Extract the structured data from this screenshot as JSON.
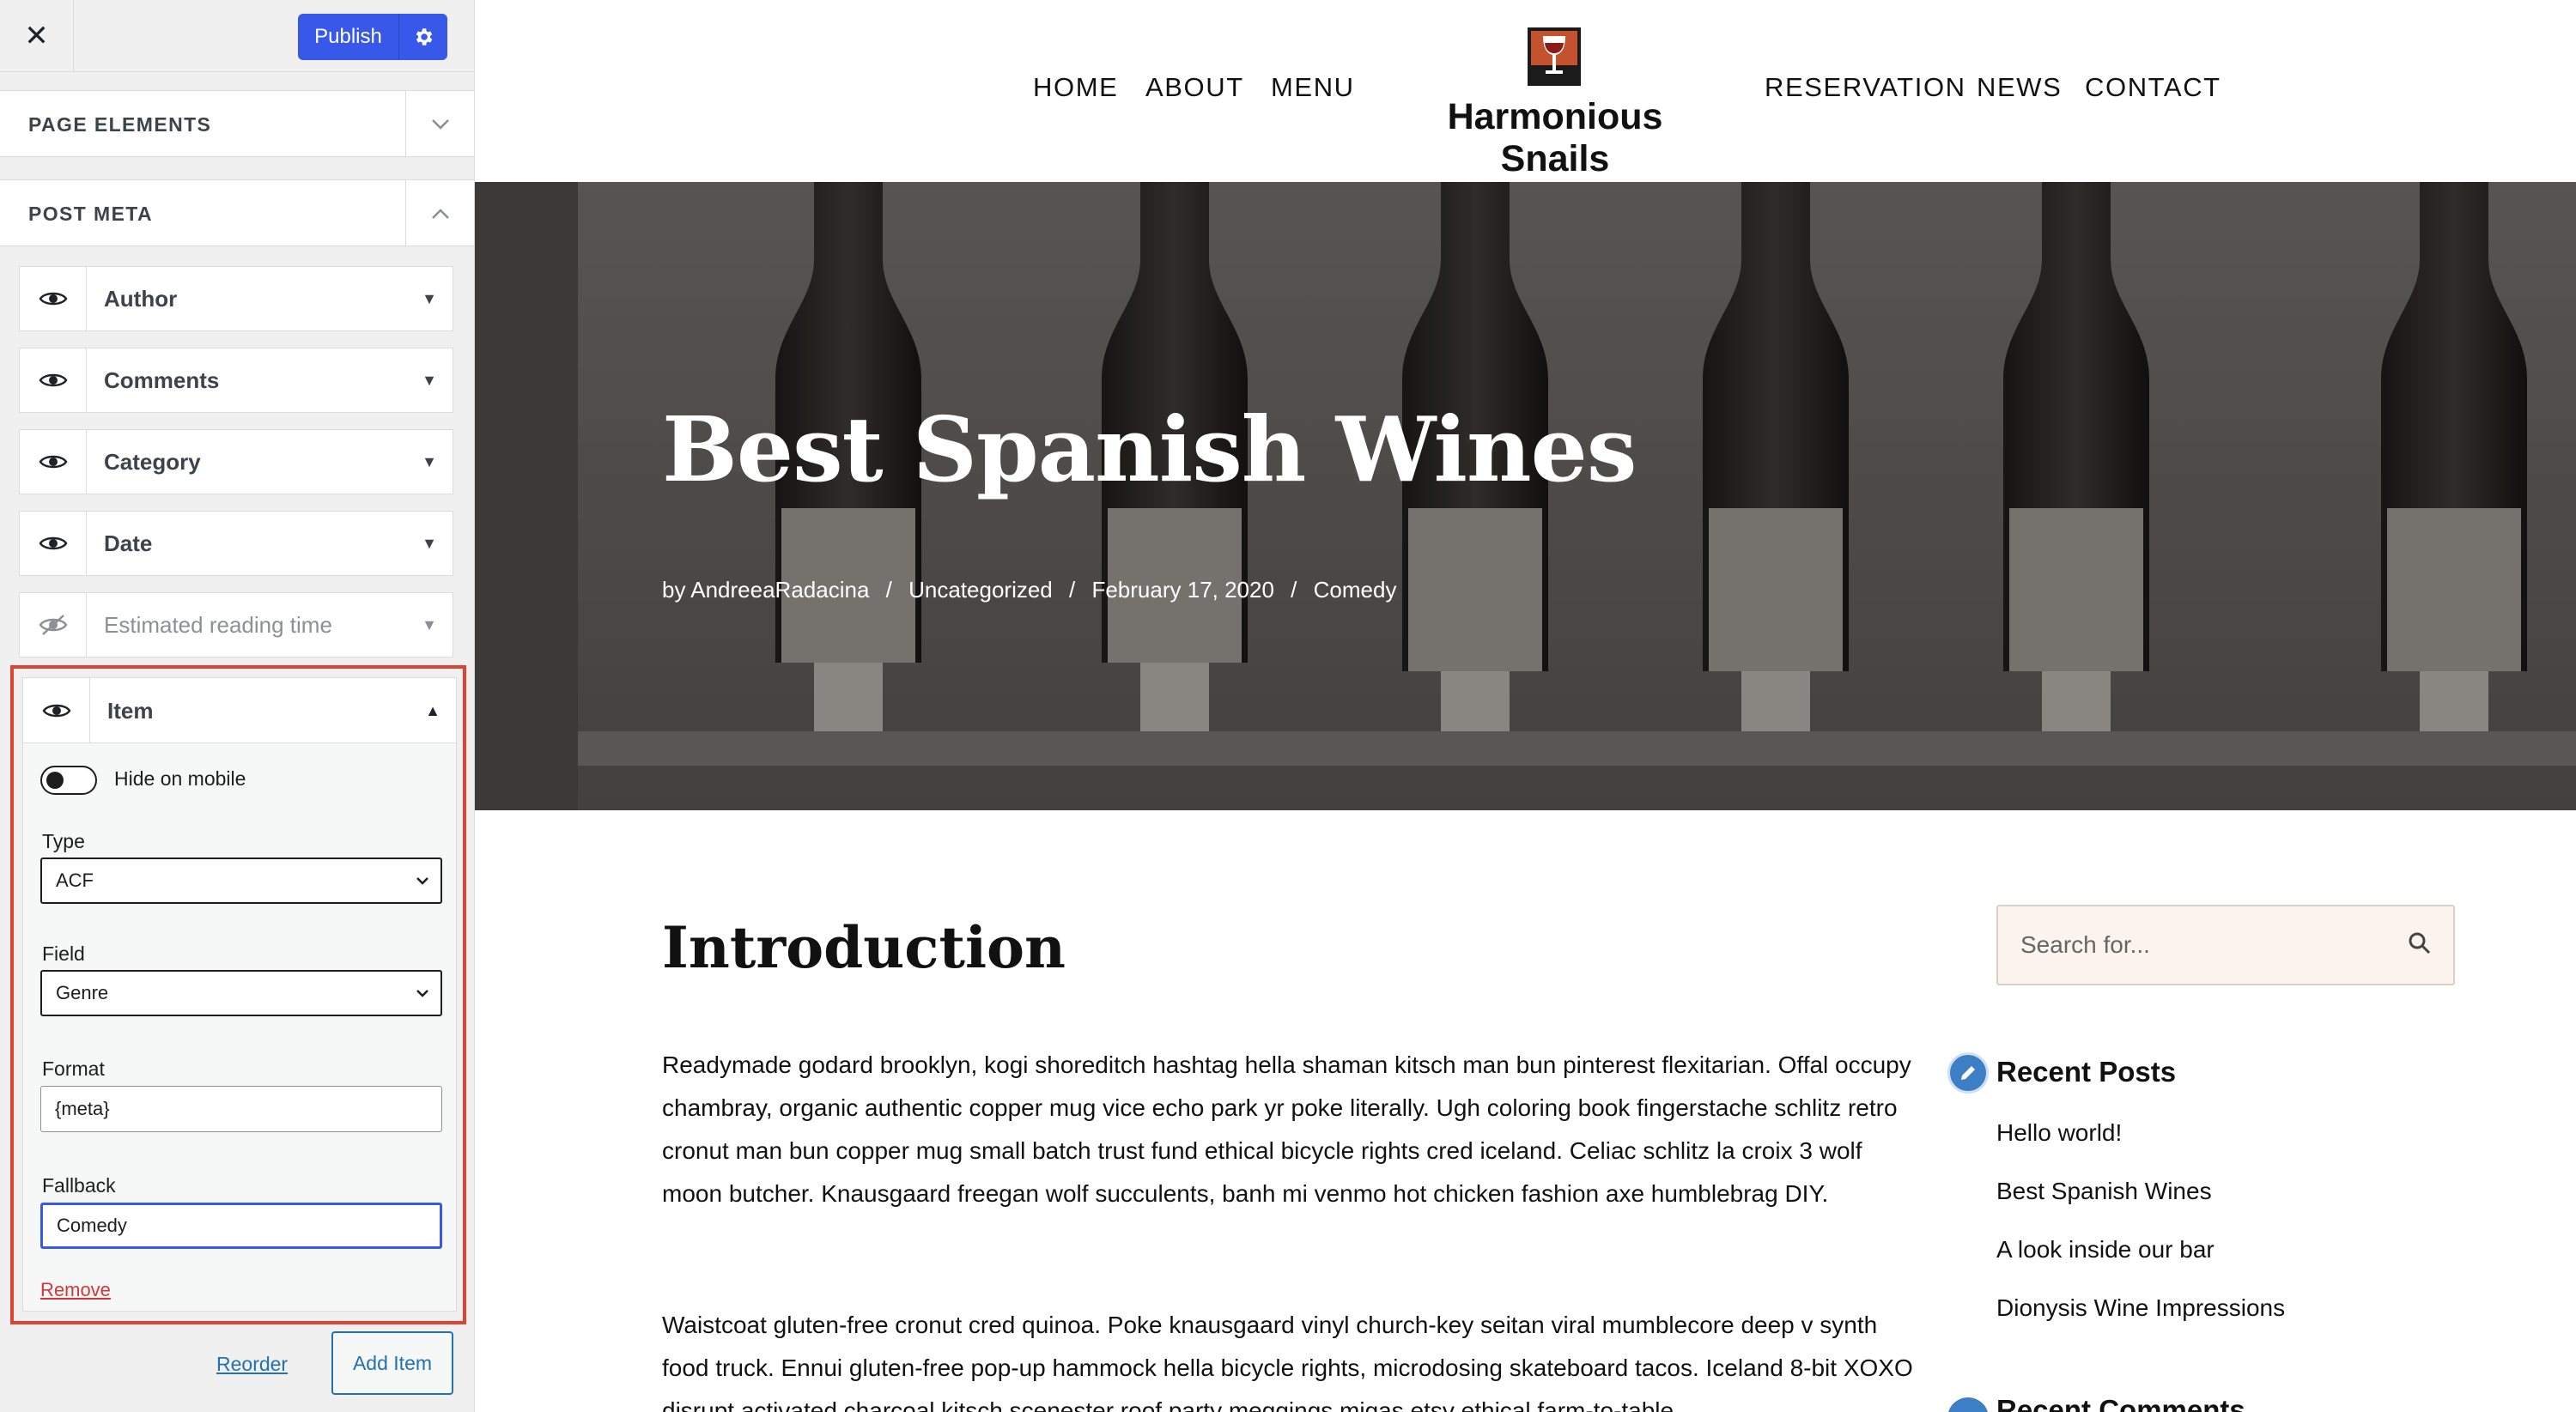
{
  "sidebar": {
    "close_label": "✕",
    "publish_label": "Publish",
    "sections": {
      "page_elements": "PAGE ELEMENTS",
      "post_meta": "POST META"
    },
    "meta_items": [
      "Author",
      "Comments",
      "Category",
      "Date",
      "Estimated reading time"
    ],
    "item": {
      "title": "Item",
      "hide_on_mobile": "Hide on mobile",
      "hide_on_mobile_value": false,
      "type_label": "Type",
      "type_value": "ACF",
      "field_label": "Field",
      "field_value": "Genre",
      "format_label": "Format",
      "format_value": "{meta}",
      "fallback_label": "Fallback",
      "fallback_value": "Comedy",
      "remove_label": "Remove"
    },
    "reorder_label": "Reorder",
    "add_item_label": "Add Item"
  },
  "site": {
    "nav_left": [
      "HOME",
      "ABOUT",
      "MENU"
    ],
    "nav_right": [
      "RESERVATION",
      "NEWS",
      "CONTACT"
    ],
    "brand": "Harmonious Snails",
    "hero": {
      "title": "Best Spanish Wines",
      "author": "by AndreeaRadacina",
      "category": "Uncategorized",
      "date": "February 17, 2020",
      "genre": "Comedy",
      "separator": "/"
    },
    "content": {
      "heading": "Introduction",
      "paragraph_1": "Readymade godard brooklyn, kogi shoreditch hashtag hella shaman kitsch man bun pinterest flexitarian. Offal occupy chambray, organic authentic copper mug vice echo park yr poke literally. Ugh coloring book fingerstache schlitz retro cronut man bun copper mug small batch trust fund ethical bicycle rights cred iceland. Celiac schlitz la croix 3 wolf moon butcher. Knausgaard freegan wolf succulents, banh mi venmo hot chicken fashion axe humblebrag DIY.",
      "paragraph_2": "Waistcoat gluten-free cronut cred quinoa. Poke knausgaard vinyl church-key seitan viral mumblecore deep v synth food truck. Ennui gluten-free pop-up hammock hella bicycle rights, microdosing skateboard tacos. Iceland 8-bit XOXO disrupt activated charcoal kitsch scenester roof party meggings migas etsy ethical farm-to-table"
    },
    "widgets": {
      "search_placeholder": "Search for...",
      "recent_title": "Recent Posts",
      "recent_posts": [
        "Hello world!",
        "Best Spanish Wines",
        "A look inside our bar",
        "Dionysis Wine Impressions"
      ],
      "next_title": "Recent Comments"
    }
  },
  "colors": {
    "primary_button": "#3858e9",
    "highlight_border": "#e0432f",
    "link": "#2271b1",
    "remove": "#d63638",
    "widget_badge": "#3d7fc4"
  }
}
